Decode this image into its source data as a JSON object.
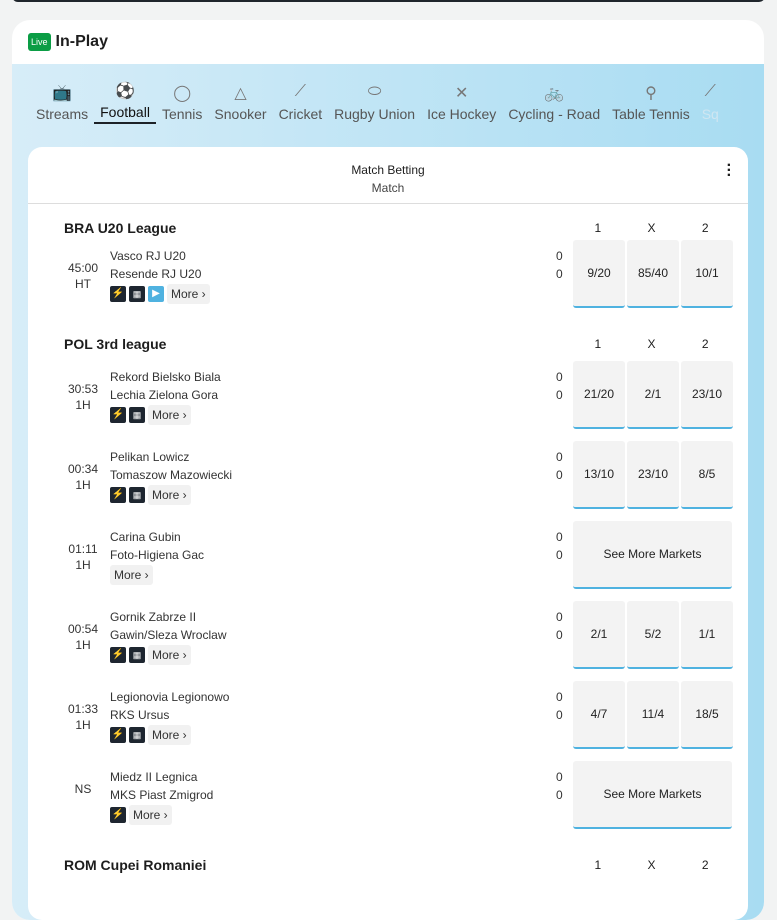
{
  "header": {
    "live_badge": "Live",
    "title": "In-Play"
  },
  "sports_tabs": [
    {
      "label": "Streams",
      "icon": "tv-icon",
      "glyph": "📺"
    },
    {
      "label": "Football",
      "icon": "football-icon",
      "glyph": "⚽",
      "active": true
    },
    {
      "label": "Tennis",
      "icon": "tennis-icon",
      "glyph": "◯"
    },
    {
      "label": "Snooker",
      "icon": "snooker-icon",
      "glyph": "△"
    },
    {
      "label": "Cricket",
      "icon": "cricket-icon",
      "glyph": "⟋"
    },
    {
      "label": "Rugby Union",
      "icon": "rugby-icon",
      "glyph": "⬭"
    },
    {
      "label": "Ice Hockey",
      "icon": "ice-hockey-icon",
      "glyph": "✕"
    },
    {
      "label": "Cycling - Road",
      "icon": "cycling-icon",
      "glyph": "🚲"
    },
    {
      "label": "Table Tennis",
      "icon": "table-tennis-icon",
      "glyph": "⚲"
    },
    {
      "label": "Sq",
      "icon": "squash-icon",
      "glyph": "⟋"
    }
  ],
  "market": {
    "title": "Match Betting",
    "subtitle": "Match"
  },
  "more_label": "More ›",
  "see_more_label": "See More Markets",
  "leagues": [
    {
      "name": "BRA U20 League",
      "cols": [
        "1",
        "X",
        "2"
      ],
      "events": [
        {
          "time": "45:00",
          "period": "HT",
          "home": "Vasco RJ U20",
          "away": "Resende RJ U20",
          "home_score": "0",
          "away_score": "0",
          "icons": [
            "bolt",
            "stats",
            "video"
          ],
          "odds": [
            "9/20",
            "85/40",
            "10/1"
          ]
        }
      ]
    },
    {
      "name": "POL 3rd league",
      "cols": [
        "1",
        "X",
        "2"
      ],
      "events": [
        {
          "time": "30:53",
          "period": "1H",
          "home": "Rekord Bielsko Biala",
          "away": "Lechia Zielona Gora",
          "home_score": "0",
          "away_score": "0",
          "icons": [
            "bolt",
            "stats"
          ],
          "odds": [
            "21/20",
            "2/1",
            "23/10"
          ]
        },
        {
          "time": "00:34",
          "period": "1H",
          "home": "Pelikan Lowicz",
          "away": "Tomaszow Mazowiecki",
          "home_score": "0",
          "away_score": "0",
          "icons": [
            "bolt",
            "stats"
          ],
          "odds": [
            "13/10",
            "23/10",
            "8/5"
          ]
        },
        {
          "time": "01:11",
          "period": "1H",
          "home": "Carina Gubin",
          "away": "Foto-Higiena Gac",
          "home_score": "0",
          "away_score": "0",
          "icons": [],
          "odds": []
        },
        {
          "time": "00:54",
          "period": "1H",
          "home": "Gornik Zabrze II",
          "away": "Gawin/Sleza Wroclaw",
          "home_score": "0",
          "away_score": "0",
          "icons": [
            "bolt",
            "stats"
          ],
          "odds": [
            "2/1",
            "5/2",
            "1/1"
          ]
        },
        {
          "time": "01:33",
          "period": "1H",
          "home": "Legionovia Legionowo",
          "away": "RKS Ursus",
          "home_score": "0",
          "away_score": "0",
          "icons": [
            "bolt",
            "stats"
          ],
          "odds": [
            "4/7",
            "11/4",
            "18/5"
          ]
        },
        {
          "time": "NS",
          "period": "",
          "home": "Miedz II Legnica",
          "away": "MKS Piast Zmigrod",
          "home_score": "0",
          "away_score": "0",
          "icons": [
            "bolt"
          ],
          "odds": []
        }
      ]
    },
    {
      "name": "ROM Cupei Romaniei",
      "cols": [
        "1",
        "X",
        "2"
      ],
      "events": []
    }
  ]
}
